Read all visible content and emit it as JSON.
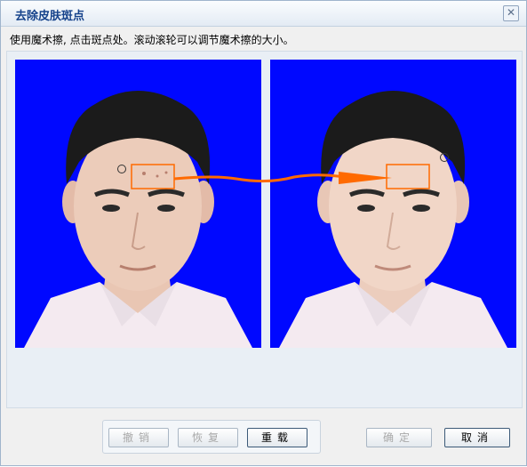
{
  "window": {
    "title": "去除皮肤斑点",
    "close_symbol": "✕"
  },
  "instruction": "使用魔术擦, 点击斑点处。滚动滚轮可以调节魔术擦的大小。",
  "images": {
    "before_name": "portrait-before",
    "after_name": "portrait-after",
    "background_color": "#0008ff",
    "highlight_color": "#ff6a00"
  },
  "buttons": {
    "undo": "撤销",
    "redo": "恢复",
    "reset": "重载",
    "ok": "确定",
    "cancel": "取消"
  },
  "button_states": {
    "undo_enabled": false,
    "redo_enabled": false,
    "reset_enabled": true,
    "ok_enabled": false,
    "cancel_enabled": true
  }
}
